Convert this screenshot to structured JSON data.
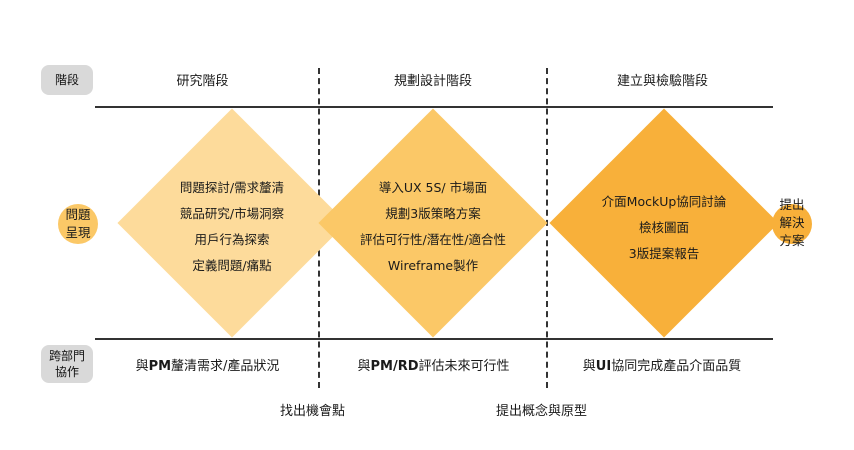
{
  "rows": {
    "stage_label": "階段",
    "problem_label_line1": "問題",
    "problem_label_line2": "呈現",
    "cross_label_line1": "跨部門",
    "cross_label_line2": "協作"
  },
  "stages": [
    {
      "title": "研究階段"
    },
    {
      "title": "規劃設計階段"
    },
    {
      "title": "建立與檢驗階段"
    }
  ],
  "diamonds": [
    {
      "color": "#fddb9b",
      "lines": [
        "問題探討/需求釐清",
        "競品研究/市場洞察",
        "用戶行為探索",
        "定義問題/痛點"
      ]
    },
    {
      "color": "#fbc867",
      "lines": [
        "導入UX 5S/ 市場面",
        "規劃3版策略方案",
        "評估可行性/潛在性/適合性",
        "Wireframe製作"
      ]
    },
    {
      "color": "#f8b03a",
      "lines": [
        "介面MockUp協同討論",
        "檢核圖面",
        "3版提案報告"
      ]
    }
  ],
  "collaboration": [
    {
      "prefix": "與",
      "bold": "PM",
      "rest": "釐清需求/產品狀況"
    },
    {
      "prefix": "與",
      "bold": "PM/RD",
      "rest": "評估未來可行性"
    },
    {
      "prefix": "與",
      "bold": "UI",
      "rest": "協同完成產品介面品質"
    }
  ],
  "notes": {
    "find_opportunity": "找出機會點",
    "propose_concept": "提出概念與原型"
  },
  "end_badge": {
    "line1": "提出",
    "line2": "解決",
    "line3": "方案"
  },
  "colors": {
    "line": "#333333",
    "pill": "#d9d9d9",
    "accent": "#f8b03a"
  }
}
